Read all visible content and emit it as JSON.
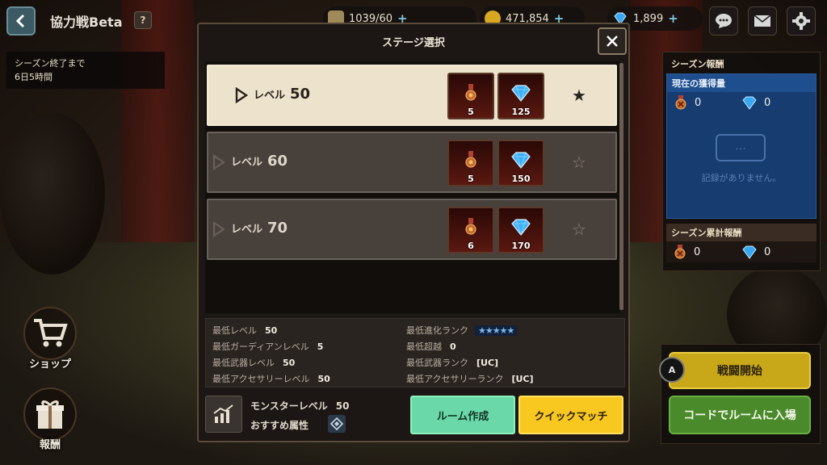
{
  "header": {
    "title": "協力戦Beta",
    "help": "?",
    "currencies": [
      {
        "name": "stamina",
        "value": "1039/60",
        "icon": "stamina-icon"
      },
      {
        "name": "gold",
        "value": "471,854",
        "icon": "gold-coin-icon"
      },
      {
        "name": "gems",
        "value": "1,899",
        "icon": "gem-icon"
      }
    ],
    "plus": "+"
  },
  "season": {
    "label": "シーズン終了まで",
    "remaining": "6日5時間"
  },
  "side": {
    "shop": "ショップ",
    "reward": "報酬"
  },
  "reward_panel": {
    "title": "シーズン報酬",
    "current_title": "現在の獲得量",
    "current_medal": "0",
    "current_gem": "0",
    "empty_icon": "…",
    "empty_text": "記録がありません。",
    "cumulative_title": "シーズン累計報酬",
    "cumulative_medal": "0",
    "cumulative_gem": "0"
  },
  "actions": {
    "key": "A",
    "start": "戦闘開始",
    "join_code": "コードでルームに入場"
  },
  "modal": {
    "title": "ステージ選択",
    "stages": [
      {
        "label": "レベル",
        "level": "50",
        "medals": "5",
        "gems": "125",
        "selected": true
      },
      {
        "label": "レベル",
        "level": "60",
        "medals": "5",
        "gems": "150",
        "selected": false
      },
      {
        "label": "レベル",
        "level": "70",
        "medals": "6",
        "gems": "170",
        "selected": false
      }
    ],
    "requirements": {
      "min_level_label": "最低レベル",
      "min_level": "50",
      "min_guardian_label": "最低ガーディアンレベル",
      "min_guardian": "5",
      "min_weapon_label": "最低武器レベル",
      "min_weapon": "50",
      "min_accessory_label": "最低アクセサリーレベル",
      "min_accessory": "50",
      "min_evo_label": "最低進化ランク",
      "min_evo_stars": "★★★★★",
      "min_transcend_label": "最低超越",
      "min_transcend": "0",
      "min_weapon_rank_label": "最低武器ランク",
      "min_weapon_rank": "[UC]",
      "min_accessory_rank_label": "最低アクセサリーランク",
      "min_accessory_rank": "[UC]"
    },
    "monster_level_label": "モンスターレベル",
    "monster_level": "50",
    "recommended_attr_label": "おすすめ属性",
    "create_room": "ルーム作成",
    "quick_match": "クイックマッチ"
  },
  "colors": {
    "selected_row": "#ede2cc",
    "create_room": "#6ad8a8",
    "quick_match": "#f8c820",
    "start": "#c8a818",
    "join": "#4a8a2a"
  }
}
